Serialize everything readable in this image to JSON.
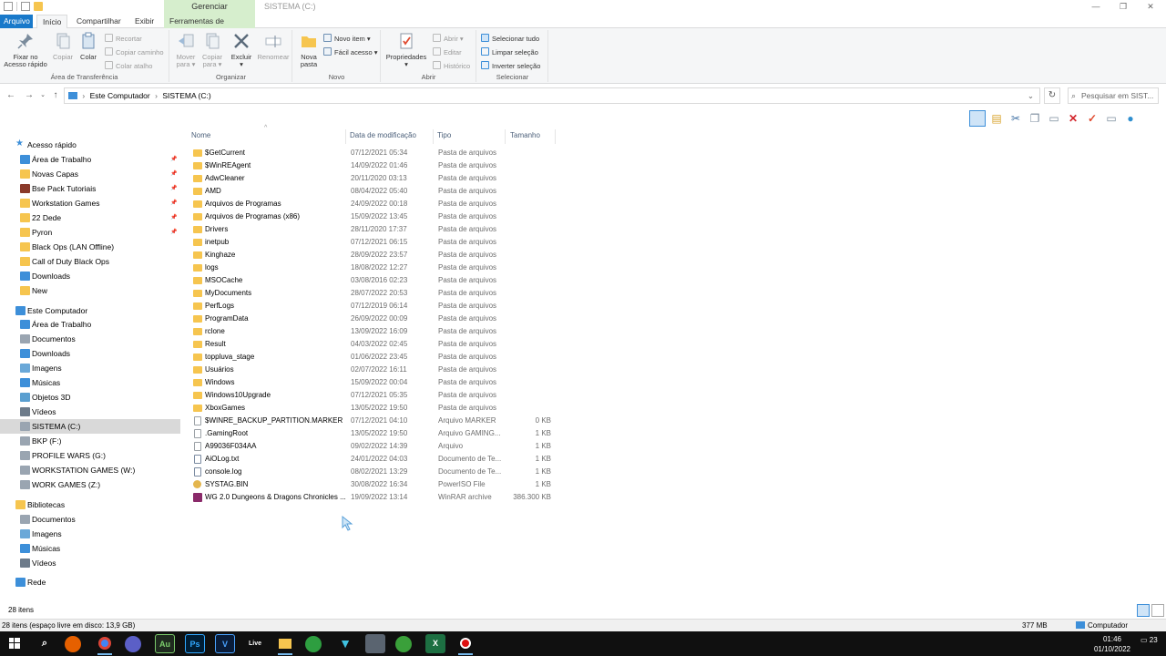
{
  "window": {
    "title": "SISTEMA (C:)",
    "context_tab_group": "Gerenciar",
    "minimize": "—",
    "restore": "❐",
    "close": "✕"
  },
  "ribbon_tabs": {
    "file": "Arquivo",
    "home": "Início",
    "share": "Compartilhar",
    "view": "Exibir",
    "drive_tools": "Ferramentas de Unidade"
  },
  "ribbon": {
    "clipboard": {
      "label": "Área de Transferência",
      "pin_quick_access_1": "Fixar no",
      "pin_quick_access_2": "Acesso rápido",
      "copy": "Copiar",
      "paste": "Colar",
      "cut": "Recortar",
      "copy_path": "Copiar caminho",
      "paste_shortcut": "Colar atalho"
    },
    "organize": {
      "label": "Organizar",
      "move_to_1": "Mover",
      "move_to_2": "para ▾",
      "copy_to_1": "Copiar",
      "copy_to_2": "para ▾",
      "delete_1": "Excluir",
      "delete_2": "▾",
      "rename": "Renomear"
    },
    "new": {
      "label": "Novo",
      "new_folder_1": "Nova",
      "new_folder_2": "pasta",
      "new_item": "Novo item ▾",
      "easy_access": "Fácil acesso ▾"
    },
    "open": {
      "label": "Abrir",
      "properties": "Propriedades",
      "properties_arrow": "▾",
      "open": "Abrir ▾",
      "edit": "Editar",
      "history": "Histórico"
    },
    "select": {
      "label": "Selecionar",
      "select_all": "Selecionar tudo",
      "select_none": "Limpar seleção",
      "invert": "Inverter seleção"
    }
  },
  "address": {
    "root": "Este Computador",
    "current": "SISTEMA (C:)",
    "search_placeholder": "Pesquisar em SIST..."
  },
  "nav": {
    "quick_access": "Acesso rápido",
    "quick_items": [
      {
        "label": "Área de Trabalho",
        "pinned": true
      },
      {
        "label": "Novas Capas",
        "pinned": true
      },
      {
        "label": "Bse Pack Tutoriais",
        "pinned": true
      },
      {
        "label": "Workstation Games",
        "pinned": true
      },
      {
        "label": "22 Dede",
        "pinned": true
      },
      {
        "label": "Pyron",
        "pinned": true
      },
      {
        "label": "Black Ops (LAN Offline)",
        "pinned": false
      },
      {
        "label": "Call of Duty Black Ops",
        "pinned": false
      },
      {
        "label": "Downloads",
        "pinned": false
      },
      {
        "label": "New",
        "pinned": false
      }
    ],
    "this_pc": "Este Computador",
    "pc_items": [
      "Área de Trabalho",
      "Documentos",
      "Downloads",
      "Imagens",
      "Músicas",
      "Objetos 3D",
      "Vídeos",
      "SISTEMA (C:)",
      "BKP (F:)",
      "PROFILE WARS (G:)",
      "WORKSTATION GAMES (W:)",
      "WORK GAMES (Z:)"
    ],
    "libraries": "Bibliotecas",
    "lib_items": [
      "Documentos",
      "Imagens",
      "Músicas",
      "Vídeos"
    ],
    "network": "Rede"
  },
  "columns": {
    "name": "Nome",
    "date": "Data de modificação",
    "type": "Tipo",
    "size": "Tamanho"
  },
  "files": [
    {
      "name": "$GetCurrent",
      "date": "07/12/2021 05:34",
      "type": "Pasta de arquivos",
      "size": "",
      "icon": "folder"
    },
    {
      "name": "$WinREAgent",
      "date": "14/09/2022 01:46",
      "type": "Pasta de arquivos",
      "size": "",
      "icon": "folder"
    },
    {
      "name": "AdwCleaner",
      "date": "20/11/2020 03:13",
      "type": "Pasta de arquivos",
      "size": "",
      "icon": "folder"
    },
    {
      "name": "AMD",
      "date": "08/04/2022 05:40",
      "type": "Pasta de arquivos",
      "size": "",
      "icon": "folder"
    },
    {
      "name": "Arquivos de Programas",
      "date": "24/09/2022 00:18",
      "type": "Pasta de arquivos",
      "size": "",
      "icon": "folder"
    },
    {
      "name": "Arquivos de Programas (x86)",
      "date": "15/09/2022 13:45",
      "type": "Pasta de arquivos",
      "size": "",
      "icon": "folder"
    },
    {
      "name": "Drivers",
      "date": "28/11/2020 17:37",
      "type": "Pasta de arquivos",
      "size": "",
      "icon": "folder"
    },
    {
      "name": "inetpub",
      "date": "07/12/2021 06:15",
      "type": "Pasta de arquivos",
      "size": "",
      "icon": "folder"
    },
    {
      "name": "Kinghaze",
      "date": "28/09/2022 23:57",
      "type": "Pasta de arquivos",
      "size": "",
      "icon": "folder"
    },
    {
      "name": "logs",
      "date": "18/08/2022 12:27",
      "type": "Pasta de arquivos",
      "size": "",
      "icon": "folder"
    },
    {
      "name": "MSOCache",
      "date": "03/08/2016 02:23",
      "type": "Pasta de arquivos",
      "size": "",
      "icon": "folder"
    },
    {
      "name": "MyDocuments",
      "date": "28/07/2022 20:53",
      "type": "Pasta de arquivos",
      "size": "",
      "icon": "folder"
    },
    {
      "name": "PerfLogs",
      "date": "07/12/2019 06:14",
      "type": "Pasta de arquivos",
      "size": "",
      "icon": "folder"
    },
    {
      "name": "ProgramData",
      "date": "26/09/2022 00:09",
      "type": "Pasta de arquivos",
      "size": "",
      "icon": "folder"
    },
    {
      "name": "rclone",
      "date": "13/09/2022 16:09",
      "type": "Pasta de arquivos",
      "size": "",
      "icon": "folder"
    },
    {
      "name": "Result",
      "date": "04/03/2022 02:45",
      "type": "Pasta de arquivos",
      "size": "",
      "icon": "folder"
    },
    {
      "name": "toppluva_stage",
      "date": "01/06/2022 23:45",
      "type": "Pasta de arquivos",
      "size": "",
      "icon": "folder"
    },
    {
      "name": "Usuários",
      "date": "02/07/2022 16:11",
      "type": "Pasta de arquivos",
      "size": "",
      "icon": "folder"
    },
    {
      "name": "Windows",
      "date": "15/09/2022 00:04",
      "type": "Pasta de arquivos",
      "size": "",
      "icon": "folder"
    },
    {
      "name": "Windows10Upgrade",
      "date": "07/12/2021 05:35",
      "type": "Pasta de arquivos",
      "size": "",
      "icon": "folder"
    },
    {
      "name": "XboxGames",
      "date": "13/05/2022 19:50",
      "type": "Pasta de arquivos",
      "size": "",
      "icon": "folder"
    },
    {
      "name": "$WINRE_BACKUP_PARTITION.MARKER",
      "date": "07/12/2021 04:10",
      "type": "Arquivo MARKER",
      "size": "0 KB",
      "icon": "file"
    },
    {
      "name": ".GamingRoot",
      "date": "13/05/2022 19:50",
      "type": "Arquivo GAMING...",
      "size": "1 KB",
      "icon": "game"
    },
    {
      "name": "A99036F034AA",
      "date": "09/02/2022 14:39",
      "type": "Arquivo",
      "size": "1 KB",
      "icon": "file"
    },
    {
      "name": "AiOLog.txt",
      "date": "24/01/2022 04:03",
      "type": "Documento de Te...",
      "size": "1 KB",
      "icon": "txt"
    },
    {
      "name": "console.log",
      "date": "08/02/2021 13:29",
      "type": "Documento de Te...",
      "size": "1 KB",
      "icon": "txt"
    },
    {
      "name": "SYSTAG.BIN",
      "date": "30/08/2022 16:34",
      "type": "PowerISO File",
      "size": "1 KB",
      "icon": "iso"
    },
    {
      "name": "WG 2.0 Dungeons & Dragons Chronicles ...",
      "date": "19/09/2022 13:14",
      "type": "WinRAR archive",
      "size": "386.300 KB",
      "icon": "rar"
    }
  ],
  "status": {
    "item_count": "28 itens",
    "free_space": "28 itens (espaço livre em disco: 13,9 GB)",
    "memory": "377 MB",
    "computer": "Computador"
  },
  "taskbar": {
    "time": "01:46",
    "date": "01/10/2022",
    "notifications": "23"
  },
  "colors": {
    "accent": "#1979ca",
    "context_tab": "#d6eecd",
    "folder": "#f6c54f",
    "selection": "#d9d9d9",
    "taskbar": "#101010"
  }
}
